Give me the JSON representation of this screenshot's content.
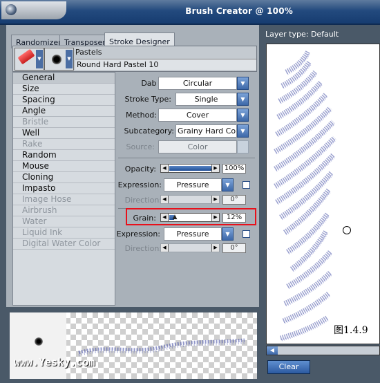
{
  "window": {
    "title": "Brush Creator @ 100%"
  },
  "tabs": [
    {
      "label": "Randomizer",
      "active": false
    },
    {
      "label": "Transposer",
      "active": false
    },
    {
      "label": "Stroke Designer",
      "active": true
    }
  ],
  "brush": {
    "category": "Pastels",
    "variant": "Round Hard Pastel 10"
  },
  "categories": [
    {
      "label": "General",
      "enabled": true,
      "selected": true
    },
    {
      "label": "Size",
      "enabled": true
    },
    {
      "label": "Spacing",
      "enabled": true
    },
    {
      "label": "Angle",
      "enabled": true
    },
    {
      "label": "Bristle",
      "enabled": false
    },
    {
      "label": "Well",
      "enabled": true
    },
    {
      "label": "Rake",
      "enabled": false
    },
    {
      "label": "Random",
      "enabled": true
    },
    {
      "label": "Mouse",
      "enabled": true
    },
    {
      "label": "Cloning",
      "enabled": true
    },
    {
      "label": "Impasto",
      "enabled": true
    },
    {
      "label": "Image Hose",
      "enabled": false
    },
    {
      "label": "Airbrush",
      "enabled": false
    },
    {
      "label": "Water",
      "enabled": false
    },
    {
      "label": "Liquid Ink",
      "enabled": false
    },
    {
      "label": "Digital Water Color",
      "enabled": false
    }
  ],
  "general": {
    "dab_type": {
      "label": "Dab Type:",
      "value": "Circular"
    },
    "stroke_type": {
      "label": "Stroke Type:",
      "value": "Single"
    },
    "method": {
      "label": "Method:",
      "value": "Cover"
    },
    "subcategory": {
      "label": "Subcategory:",
      "value": "Grainy Hard Co..."
    },
    "source": {
      "label": "Source:",
      "value": "Color"
    }
  },
  "opacity": {
    "label": "Opacity:",
    "value": "100%",
    "fraction": 1.0,
    "expression": {
      "label": "Expression:",
      "value": "Pressure"
    },
    "direction": {
      "label": "Direction:",
      "value": "0°"
    }
  },
  "grain": {
    "label": "Grain:",
    "value": "12%",
    "fraction": 0.12,
    "expression": {
      "label": "Expression:",
      "value": "Pressure"
    },
    "direction": {
      "label": "Direction:",
      "value": "0°"
    }
  },
  "canvas": {
    "layer_type": "Layer type: Default",
    "caption": "图1.4.9"
  },
  "clear_button": "Clear",
  "watermark": "www.Yesky.com",
  "colors": {
    "stroke": "#4b55a8",
    "highlight": "#e8101b",
    "accent": "#2c5aa0"
  }
}
